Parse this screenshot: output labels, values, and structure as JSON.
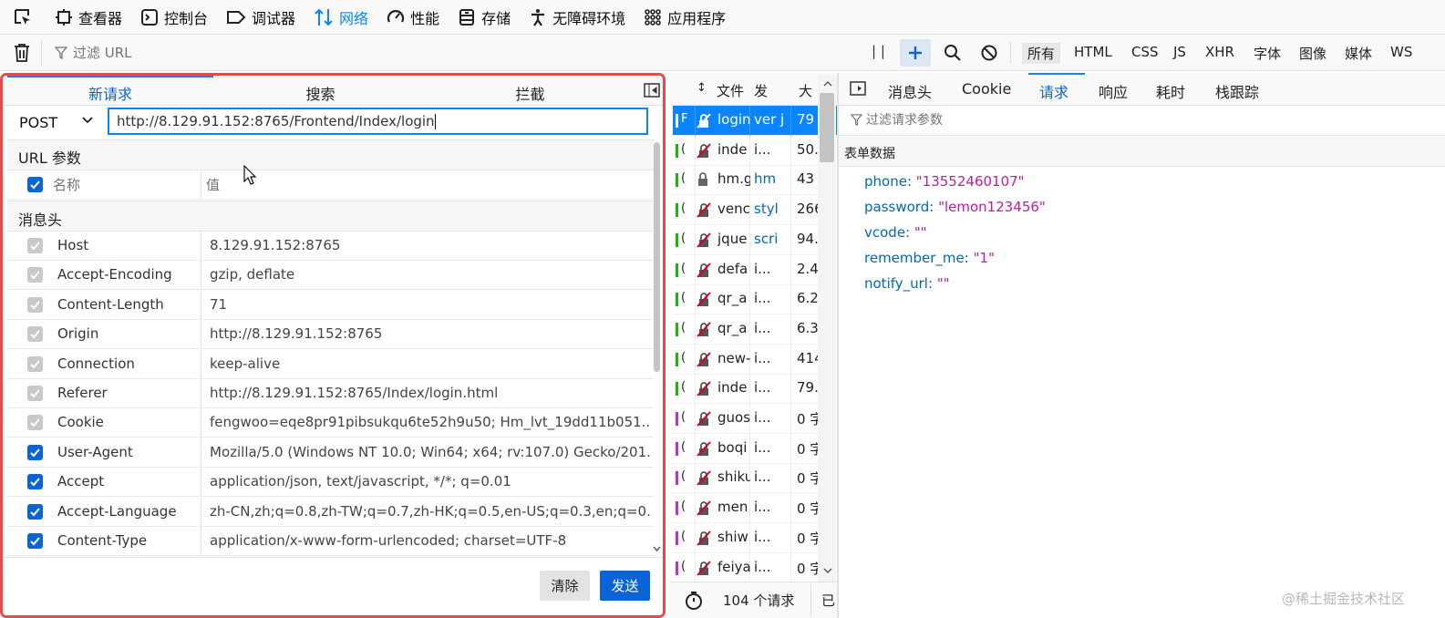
{
  "toolbar": {
    "items": [
      {
        "label": "查看器",
        "icon": "inspector-icon"
      },
      {
        "label": "控制台",
        "icon": "console-icon"
      },
      {
        "label": "调试器",
        "icon": "debugger-icon"
      },
      {
        "label": "网络",
        "icon": "network-icon",
        "selected": true
      },
      {
        "label": "性能",
        "icon": "performance-icon"
      },
      {
        "label": "存储",
        "icon": "storage-icon"
      },
      {
        "label": "无障碍环境",
        "icon": "accessibility-icon"
      },
      {
        "label": "应用程序",
        "icon": "application-icon"
      }
    ]
  },
  "filter": {
    "placeholder": "过滤 URL",
    "types": [
      "所有",
      "HTML",
      "CSS",
      "JS",
      "XHR",
      "字体",
      "图像",
      "媒体",
      "WS"
    ],
    "selected_type": "所有",
    "pause_label": "| |"
  },
  "new_request": {
    "tabs": [
      "新请求",
      "搜索",
      "拦截"
    ],
    "method": "POST",
    "url": "http://8.129.91.152:8765/Frontend/Index/login",
    "url_params_label": "URL 参数",
    "param_name_placeholder": "名称",
    "param_value_placeholder": "值",
    "headers_label": "消息头",
    "headers": [
      {
        "name": "Host",
        "value": "8.129.91.152:8765",
        "state": "disabled"
      },
      {
        "name": "Accept-Encoding",
        "value": "gzip, deflate",
        "state": "disabled"
      },
      {
        "name": "Content-Length",
        "value": "71",
        "state": "disabled"
      },
      {
        "name": "Origin",
        "value": "http://8.129.91.152:8765",
        "state": "disabled"
      },
      {
        "name": "Connection",
        "value": "keep-alive",
        "state": "disabled"
      },
      {
        "name": "Referer",
        "value": "http://8.129.91.152:8765/Index/login.html",
        "state": "disabled"
      },
      {
        "name": "Cookie",
        "value": "fengwoo=eqe8pr91pibsukqu6te52h9u50; Hm_lvt_19dd11b051...",
        "state": "disabled"
      },
      {
        "name": "User-Agent",
        "value": "Mozilla/5.0 (Windows NT 10.0; Win64; x64; rv:107.0) Gecko/201...",
        "state": "checked"
      },
      {
        "name": "Accept",
        "value": "application/json, text/javascript, */*; q=0.01",
        "state": "checked"
      },
      {
        "name": "Accept-Language",
        "value": "zh-CN,zh;q=0.8,zh-TW;q=0.7,zh-HK;q=0.5,en-US;q=0.3,en;q=0.2",
        "state": "checked"
      },
      {
        "name": "Content-Type",
        "value": "application/x-www-form-urlencoded; charset=UTF-8",
        "state": "checked"
      }
    ],
    "clear_label": "清除",
    "send_label": "发送"
  },
  "request_list": {
    "headers": [
      "↕",
      "文件",
      "发",
      "大"
    ],
    "rows": [
      {
        "status": "F",
        "file": "login",
        "initiator": "ver j",
        "size": "79",
        "selected": true,
        "color": "#ffffff"
      },
      {
        "status": "(",
        "file": "inde",
        "initiator": "i...",
        "size": "50.",
        "color": "#12bc00"
      },
      {
        "status": "(",
        "file": "hm.g",
        "initiator": "hm",
        "size": "43",
        "color": "#12bc00",
        "lock": true
      },
      {
        "status": "(",
        "file": "venc",
        "initiator": "styl",
        "size": "266",
        "color": "#12bc00"
      },
      {
        "status": "(",
        "file": "jque",
        "initiator": "scri",
        "size": "94.",
        "color": "#12bc00"
      },
      {
        "status": "(",
        "file": "defa",
        "initiator": "i...",
        "size": "2.4",
        "color": "#12bc00"
      },
      {
        "status": "(",
        "file": "qr_a",
        "initiator": "i...",
        "size": "6.2",
        "color": "#12bc00"
      },
      {
        "status": "(",
        "file": "qr_a",
        "initiator": "i...",
        "size": "6.3",
        "color": "#12bc00"
      },
      {
        "status": "(",
        "file": "new-",
        "initiator": "i...",
        "size": "414",
        "color": "#12bc00"
      },
      {
        "status": "(",
        "file": "inde",
        "initiator": "i...",
        "size": "79.",
        "color": "#12bc00"
      },
      {
        "status": "(",
        "file": "guos",
        "initiator": "i...",
        "size": "0 字",
        "color": "#c52bde"
      },
      {
        "status": "(",
        "file": "boqi",
        "initiator": "i...",
        "size": "0 字",
        "color": "#c52bde"
      },
      {
        "status": "(",
        "file": "shiku",
        "initiator": "i...",
        "size": "0 字",
        "color": "#c52bde"
      },
      {
        "status": "(",
        "file": "men",
        "initiator": "i...",
        "size": "0 字",
        "color": "#c52bde"
      },
      {
        "status": "(",
        "file": "shiw",
        "initiator": "i...",
        "size": "0 字",
        "color": "#c52bde"
      },
      {
        "status": "(",
        "file": "feiya",
        "initiator": "i...",
        "size": "0 字",
        "color": "#c52bde"
      }
    ],
    "footer_count": "104 个请求",
    "footer_more": "已"
  },
  "details": {
    "tabs": [
      "消息头",
      "Cookie",
      "请求",
      "响应",
      "耗时",
      "栈跟踪"
    ],
    "selected_tab": "请求",
    "filter_placeholder": "过滤请求参数",
    "section": "表单数据",
    "form": [
      {
        "key": "phone:",
        "value": "\"13552460107\""
      },
      {
        "key": "password:",
        "value": "\"lemon123456\""
      },
      {
        "key": "vcode:",
        "value": "\"\""
      },
      {
        "key": "remember_me:",
        "value": "\"1\""
      },
      {
        "key": "notify_url:",
        "value": "\"\""
      }
    ]
  },
  "watermark": "@稀土掘金技术社区",
  "colors": {
    "accent": "#0a84ff",
    "panel_border": "#e44c4c",
    "send_button": "#0a64d6",
    "param_key": "#0069b3",
    "param_value": "#c41a9b"
  }
}
